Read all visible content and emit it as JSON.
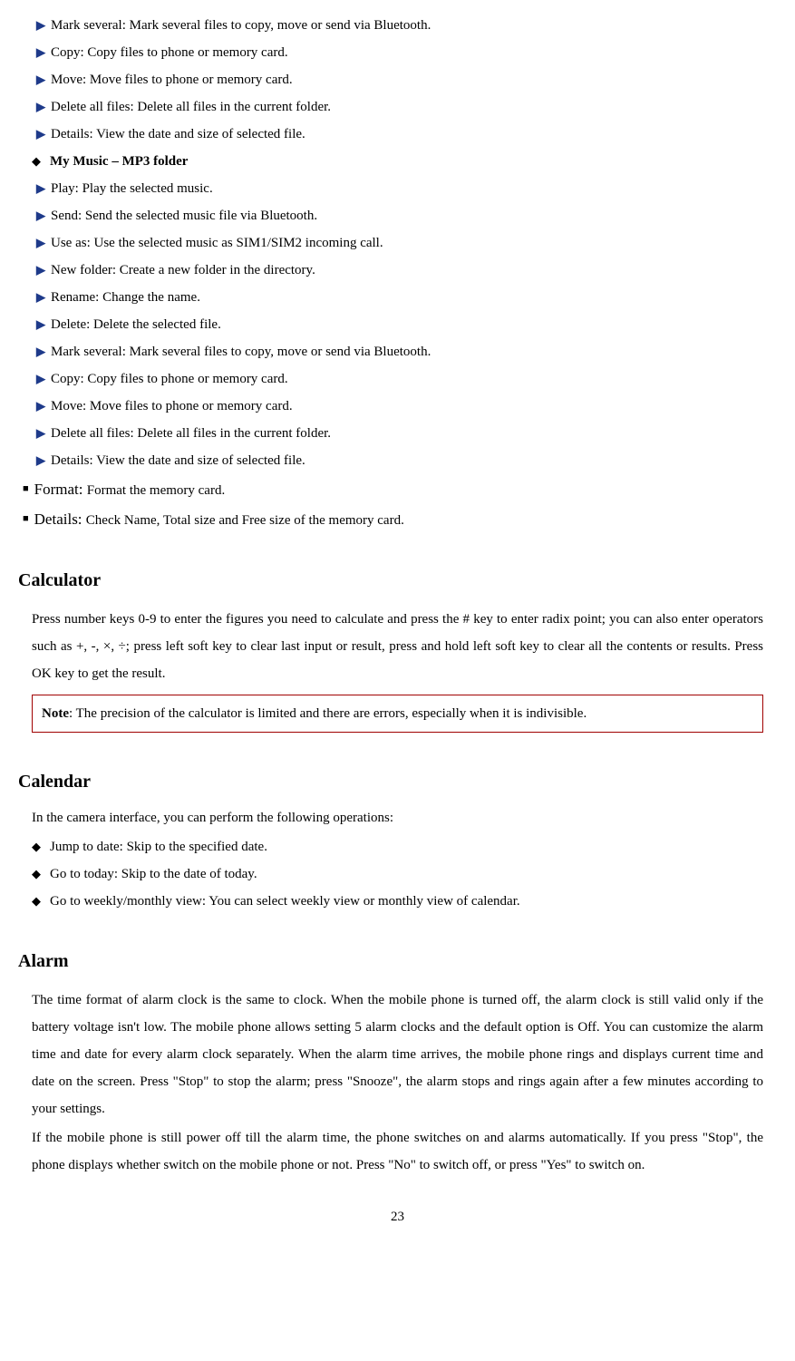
{
  "list1": [
    "Mark several: Mark several files to copy, move or send via Bluetooth.",
    "Copy: Copy files to phone or memory card.",
    "Move: Move files to phone or memory card.",
    "Delete all files: Delete all files in the current folder.",
    "Details: View the date and size of selected file."
  ],
  "mp3_heading": "My Music – MP3 folder",
  "list2": [
    "Play: Play the selected music.",
    "Send: Send the selected music file via Bluetooth.",
    "Use as: Use the selected music as SIM1/SIM2 incoming call.",
    "New folder: Create a new folder in the directory.",
    "Rename: Change the name.",
    "Delete: Delete the selected file.",
    "Mark several: Mark several files to copy, move or send via Bluetooth.",
    "Copy: Copy files to phone or memory card.",
    "Move: Move files to phone or memory card.",
    "Delete all files: Delete all files in the current folder.",
    "Details: View the date and size of selected file."
  ],
  "format_label": "Format: ",
  "format_desc": "Format the memory card.",
  "details_label": "Details: ",
  "details_desc": "Check Name, Total size and Free size of the memory card.",
  "calc_heading": "Calculator",
  "calc_body": "Press number keys 0-9 to enter the figures you need to calculate and press the # key to enter radix point; you can also enter operators such as +, -, ×, ÷; press left soft key to clear last input or result, press and hold left soft key to clear all the contents or results. Press OK key to get the result.",
  "note_label": "Note",
  "note_body": ": The precision of the calculator is limited and there are errors, especially when it is indivisible.",
  "calendar_heading": "Calendar",
  "calendar_intro": "In the camera interface, you can perform the following operations:",
  "cal_items": [
    "Jump to date: Skip to the specified date.",
    "Go to today: Skip to the date of today.",
    "Go to weekly/monthly view: You can select weekly view or monthly view of calendar."
  ],
  "alarm_heading": "Alarm",
  "alarm_p1": "The time format of alarm clock is the same to clock. When the mobile phone is turned off, the alarm clock is still valid only if the battery voltage isn't low. The mobile phone allows setting 5 alarm clocks and the default option is Off. You can customize the alarm time and date for every alarm clock separately. When the alarm time arrives, the mobile phone rings and displays current time and date on the screen. Press \"Stop\" to stop the alarm; press \"Snooze\", the alarm stops and rings again after a few minutes according to your settings.",
  "alarm_p2": "If the mobile phone is still power off till the alarm time, the phone switches on and alarms automatically. If you press \"Stop\", the phone displays whether switch on the mobile phone or not. Press \"No\" to switch off, or press \"Yes\" to switch on.",
  "page_number": "23"
}
